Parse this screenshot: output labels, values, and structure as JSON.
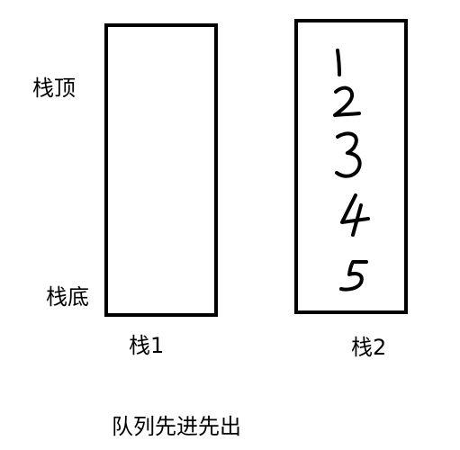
{
  "stack1": {
    "top_label": "栈顶",
    "bottom_label": "栈底",
    "caption": "栈1"
  },
  "stack2": {
    "caption": "栈2",
    "elements": [
      "1",
      "2",
      "3",
      "4",
      "5"
    ]
  },
  "caption": "队列先进先出"
}
